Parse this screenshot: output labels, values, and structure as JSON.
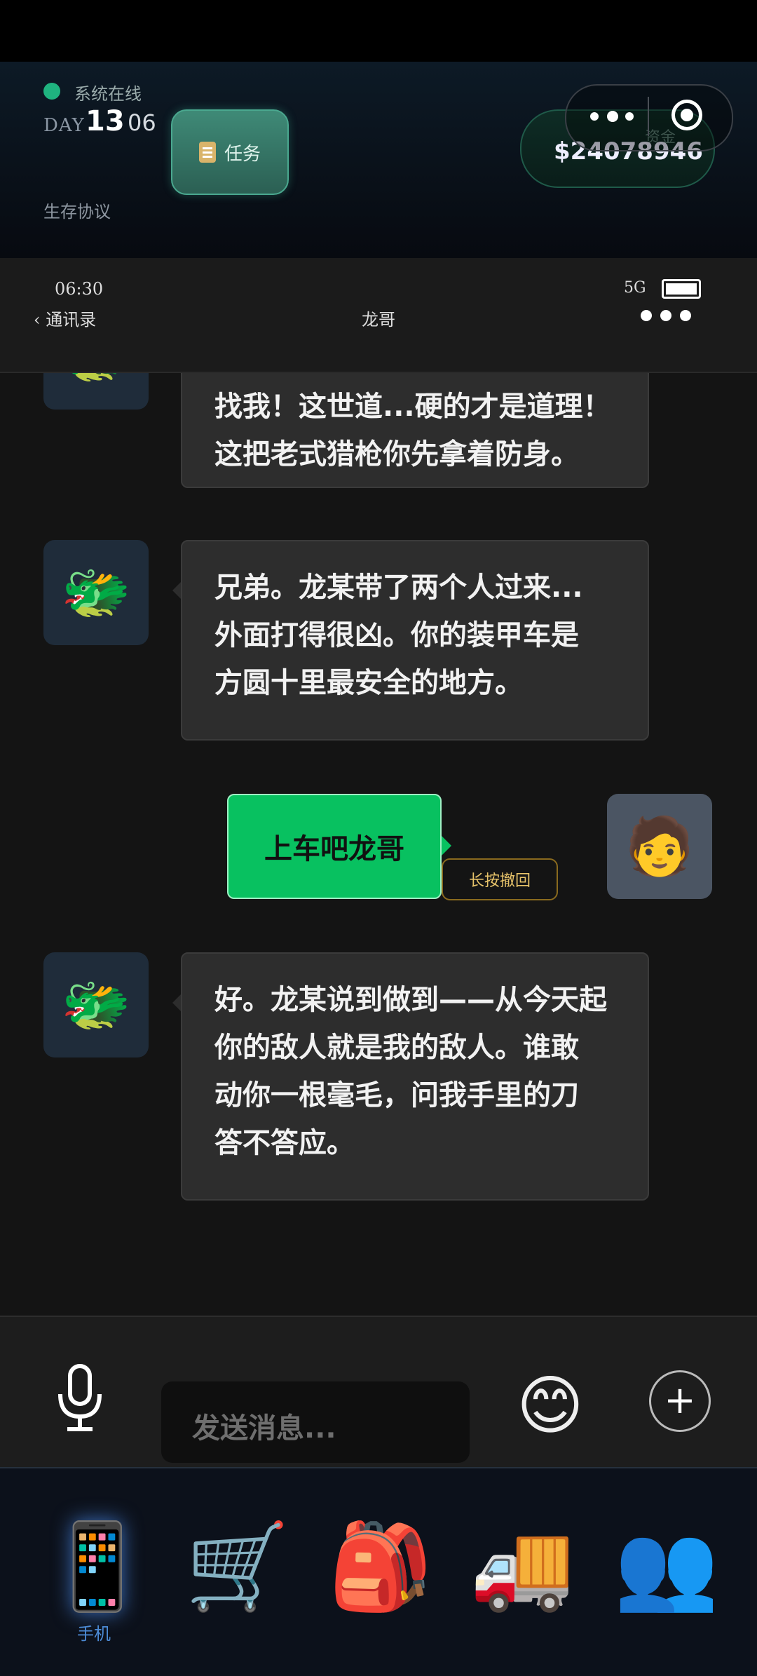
{
  "hud": {
    "status_text": "系统在线",
    "day_label": "DAY",
    "day_number": "13",
    "day_time": "06",
    "protocol_label": "生存协议",
    "task_button": {
      "icon": "clipboard-icon",
      "label": "任务"
    },
    "funds": {
      "label": "资金",
      "value": "$24078946"
    }
  },
  "phone": {
    "status_time": "06:30",
    "network": "5G",
    "back_label": "通讯录",
    "contact_name": "龙哥"
  },
  "chat": {
    "messages": [
      {
        "from": "contact",
        "avatar": "🐲",
        "lines": [
          "找我！这世道...硬的才是道理！",
          "这把老式猎枪你先拿着防身。"
        ]
      },
      {
        "from": "contact",
        "avatar": "🐲",
        "lines": [
          "兄弟。龙某带了两个人过来...",
          "外面打得很凶。你的装甲车是",
          "方圆十里最安全的地方。"
        ]
      },
      {
        "from": "me",
        "avatar": "🧑",
        "text": "上车吧龙哥",
        "recall_label": "长按撤回"
      },
      {
        "from": "contact",
        "avatar": "🐲",
        "lines": [
          "好。龙某说到做到——从今天起",
          "你的敌人就是我的敌人。谁敢",
          "动你一根毫毛，问我手里的刀",
          "答不答应。"
        ]
      }
    ]
  },
  "input": {
    "placeholder": "发送消息...",
    "emoji": "😊",
    "plus": "+"
  },
  "tabs": [
    {
      "icon": "📱",
      "label": "手机"
    },
    {
      "icon": "🛒",
      "label": ""
    },
    {
      "icon": "🎒",
      "label": ""
    },
    {
      "icon": "🚚",
      "label": ""
    },
    {
      "icon": "👥",
      "label": ""
    }
  ],
  "colors": {
    "accent_green": "#08c160",
    "online_dot": "#1fb37f",
    "tab_active": "#4c8bd6"
  }
}
